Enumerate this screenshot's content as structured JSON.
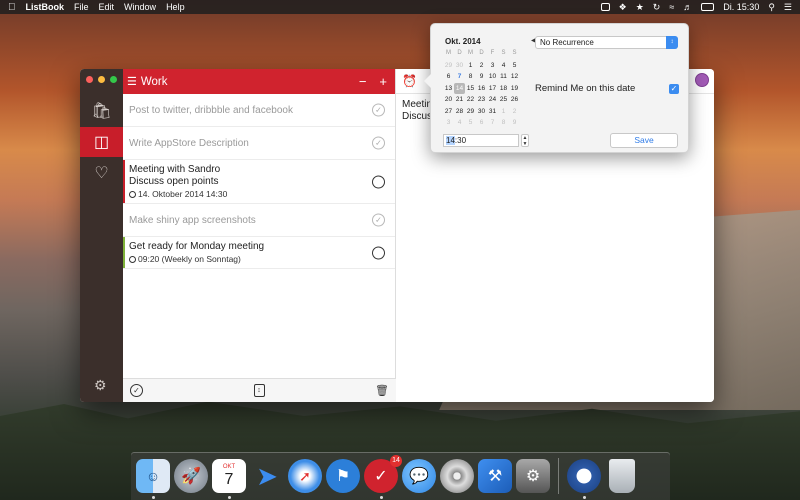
{
  "menubar": {
    "app_name": "ListBook",
    "items": [
      "File",
      "Edit",
      "Window",
      "Help"
    ],
    "clock": "Di. 15:30"
  },
  "window": {
    "list_title": "Work",
    "tasks": [
      {
        "title": "Post to twitter, dribbble and facebook",
        "done": true
      },
      {
        "title": "Write AppStore Description",
        "done": true
      },
      {
        "title": "Meeting with Sandro",
        "line2": "Discuss open points",
        "meta": "14. Oktober 2014 14:30",
        "done": false,
        "flag_color": "#c81e2a"
      },
      {
        "title": "Make shiny app screenshots",
        "done": true
      },
      {
        "title": "Get ready for Monday meeting",
        "meta": "09:20 (Weekly on Sonntag)",
        "done": false,
        "flag_color": "#7fb23a"
      }
    ],
    "detail_text_line1": "Meeting",
    "detail_text_line2": "Discuss"
  },
  "popover": {
    "month_label": "Okt. 2014",
    "weekdays": [
      "M",
      "D",
      "M",
      "D",
      "F",
      "S",
      "S"
    ],
    "weeks": [
      [
        "29",
        "30",
        "1",
        "2",
        "3",
        "4",
        "5"
      ],
      [
        "6",
        "7",
        "8",
        "9",
        "10",
        "11",
        "12"
      ],
      [
        "13",
        "14",
        "15",
        "16",
        "17",
        "18",
        "19"
      ],
      [
        "20",
        "21",
        "22",
        "23",
        "24",
        "25",
        "26"
      ],
      [
        "27",
        "28",
        "29",
        "30",
        "31",
        "1",
        "2"
      ],
      [
        "3",
        "4",
        "5",
        "6",
        "7",
        "8",
        "9"
      ]
    ],
    "recurrence": "No Recurrence",
    "remind_label": "Remind Me on this date",
    "remind_checked": true,
    "time_hour": "14",
    "time_rest": ":30",
    "save_label": "Save"
  },
  "colors": {
    "accent_red": "#d0232e",
    "sidebar": "#3b2f2b",
    "list_color_dot": "#a25bb6",
    "blue": "#3b8cf0"
  },
  "dock": {
    "apps": [
      "finder",
      "launchpad",
      "calendar",
      "send",
      "safari",
      "tags",
      "listbook",
      "messages",
      "dvd-player",
      "xcode",
      "system-preferences",
      "1password",
      "trash"
    ],
    "calendar_month": "OKT",
    "calendar_day": "7",
    "listbook_badge": "14"
  }
}
